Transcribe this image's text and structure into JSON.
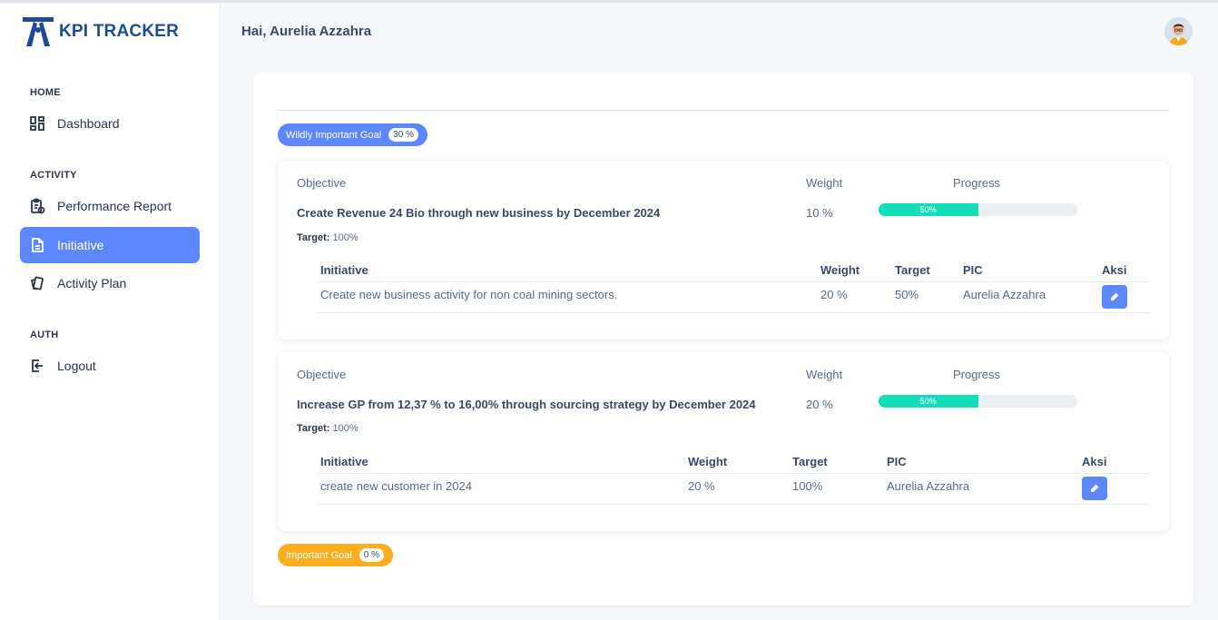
{
  "app": {
    "brand": "KPI TRACKER"
  },
  "sidebar": {
    "sections": [
      {
        "title": "HOME"
      },
      {
        "title": "ACTIVITY"
      },
      {
        "title": "AUTH"
      }
    ],
    "items": [
      {
        "label": "Dashboard",
        "icon": "dashboard-icon"
      },
      {
        "label": "Performance Report",
        "icon": "clipboard-report-icon"
      },
      {
        "label": "Initiative",
        "icon": "file-text-icon",
        "active": true
      },
      {
        "label": "Activity Plan",
        "icon": "cards-icon"
      },
      {
        "label": "Logout",
        "icon": "logout-icon"
      }
    ]
  },
  "header": {
    "greeting": "Hai, Aurelia Azzahra"
  },
  "goals": [
    {
      "label": "Wildly Important Goal",
      "percent": "30 %",
      "color": "#5d87ff"
    },
    {
      "label": "Important Goal",
      "percent": "0 %",
      "color": "#ffae1f"
    }
  ],
  "objectives": [
    {
      "objective_label": "Objective",
      "weight_label": "Weight",
      "progress_label": "Progress",
      "title": "Create Revenue 24 Bio through new business by December 2024",
      "weight": "10 %",
      "progress_text": "50%",
      "progress_value": 50,
      "target_label": "Target:",
      "target_value": "100%",
      "table": {
        "headers": [
          "Initiative",
          "Weight",
          "Target",
          "PIC",
          "Aksi"
        ],
        "rows": [
          {
            "initiative": "Create new business activity for non coal mining sectors.",
            "weight": "20 %",
            "target": "50%",
            "pic": "Aurelia Azzahra"
          }
        ]
      }
    },
    {
      "objective_label": "Objective",
      "weight_label": "Weight",
      "progress_label": "Progress",
      "title": "Increase GP from 12,37 % to 16,00% through sourcing strategy by December 2024",
      "weight": "20 %",
      "progress_text": "50%",
      "progress_value": 50,
      "target_label": "Target:",
      "target_value": "100%",
      "table": {
        "headers": [
          "Initiative",
          "Weight",
          "Target",
          "PIC",
          "Aksi"
        ],
        "rows": [
          {
            "initiative": "create new customer in 2024",
            "weight": "20 %",
            "target": "100%",
            "pic": "Aurelia Azzahra"
          }
        ]
      }
    }
  ],
  "colors": {
    "accent": "#5d87ff",
    "success": "#13deb9",
    "warning": "#ffae1f"
  }
}
